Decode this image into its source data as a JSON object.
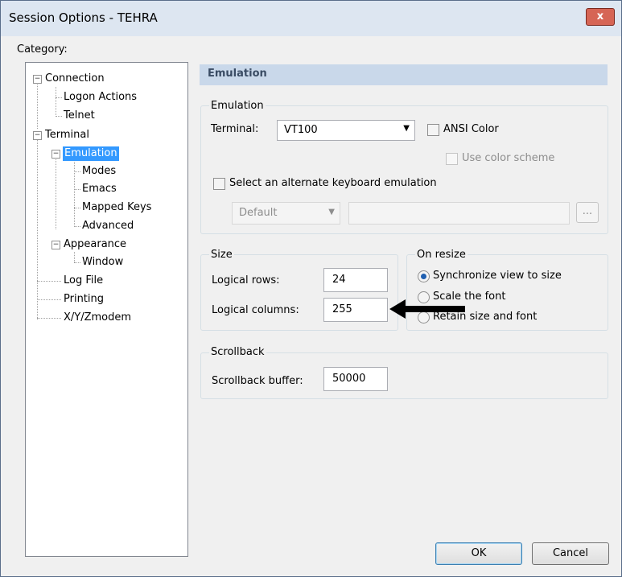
{
  "window": {
    "title": "Session Options - TEHRA",
    "close_glyph": "x"
  },
  "category_label": "Category:",
  "tree": {
    "connection": "Connection",
    "logon_actions": "Logon Actions",
    "telnet": "Telnet",
    "terminal": "Terminal",
    "emulation": "Emulation",
    "modes": "Modes",
    "emacs": "Emacs",
    "mapped_keys": "Mapped Keys",
    "advanced": "Advanced",
    "appearance": "Appearance",
    "window": "Window",
    "log_file": "Log File",
    "printing": "Printing",
    "xyz": "X/Y/Zmodem"
  },
  "panel": {
    "header": "Emulation",
    "emulation_group": {
      "title": "Emulation",
      "terminal_label": "Terminal:",
      "terminal_value": "VT100",
      "ansi_color": "ANSI Color",
      "use_color_scheme": "Use color scheme",
      "alt_keyboard": "Select an alternate keyboard emulation",
      "keyboard_value": "Default",
      "browse": "..."
    },
    "size_group": {
      "title": "Size",
      "rows_label": "Logical rows:",
      "rows_value": "24",
      "cols_label": "Logical columns:",
      "cols_value": "255"
    },
    "resize_group": {
      "title": "On resize",
      "options": [
        "Synchronize view to size",
        "Scale the font",
        "Retain size and font"
      ],
      "selected": 0
    },
    "scrollback_group": {
      "title": "Scrollback",
      "buffer_label": "Scrollback buffer:",
      "buffer_value": "50000"
    }
  },
  "buttons": {
    "ok": "OK",
    "cancel": "Cancel"
  }
}
